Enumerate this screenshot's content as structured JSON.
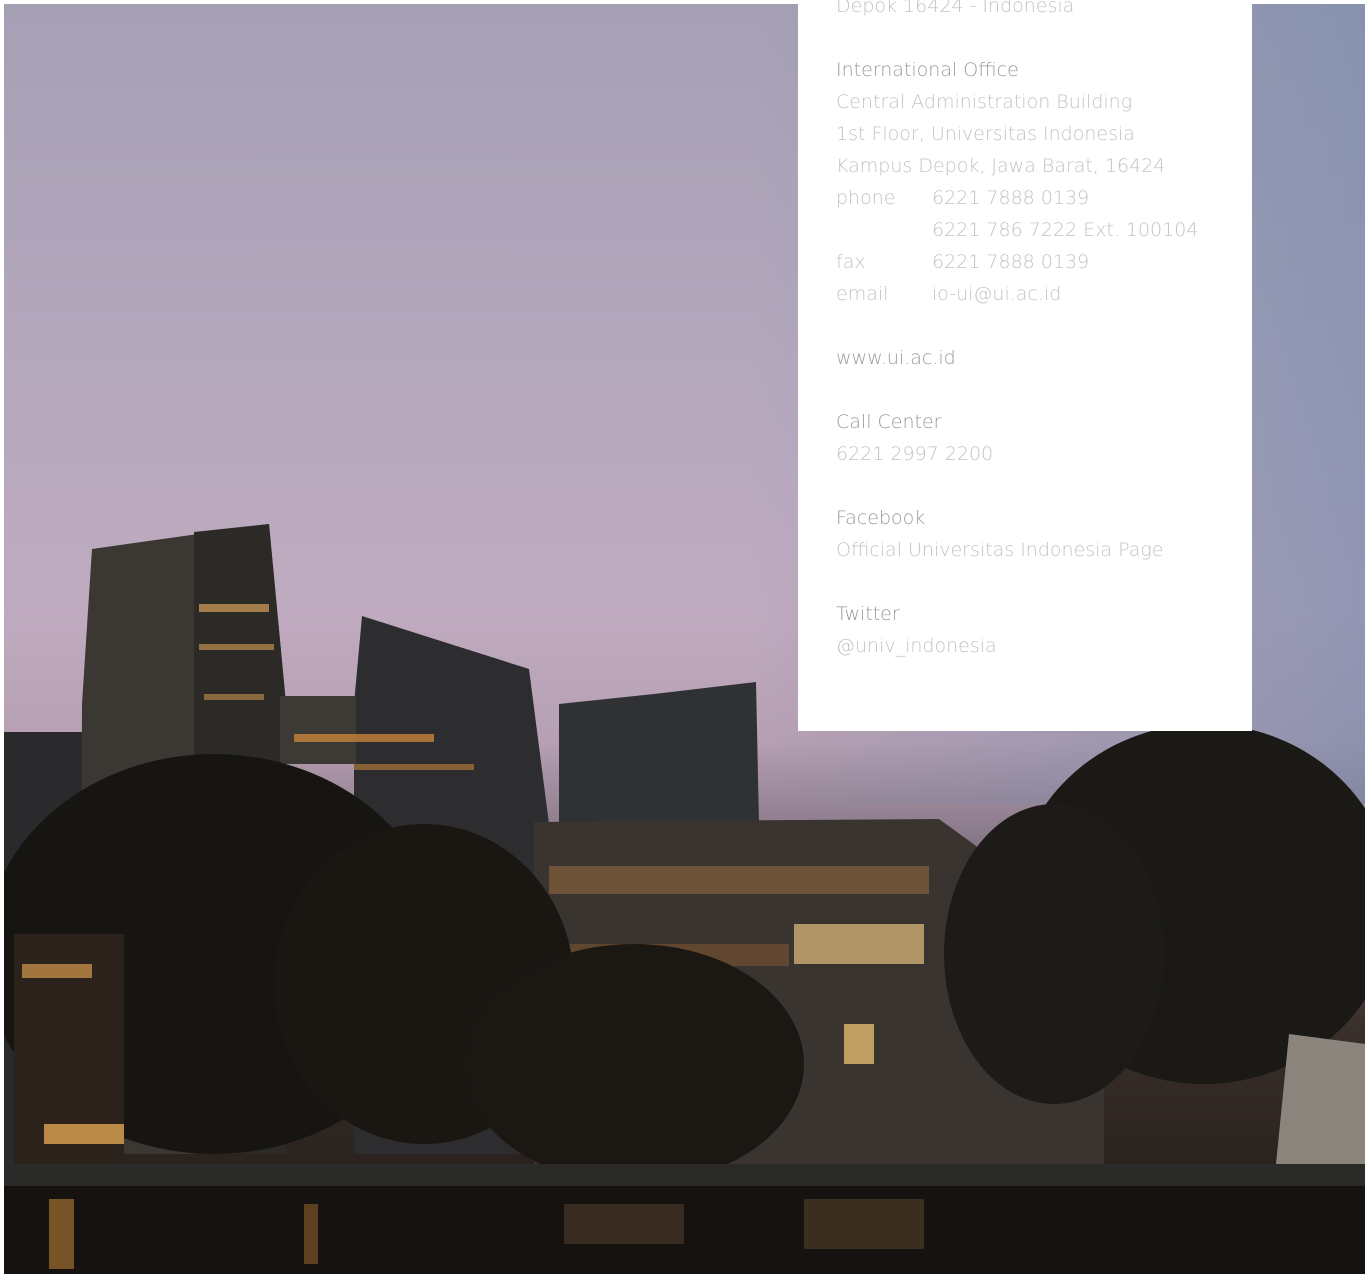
{
  "address_tail": "Depok 16424 - Indonesia",
  "international_office": {
    "heading": "International Office",
    "lines": [
      "Central Administration Building",
      "1st Floor, Universitas Indonesia",
      "Kampus Depok, Jawa Barat, 16424"
    ],
    "phone_label": "phone",
    "phone_1": "6221 7888 0139",
    "phone_2": "6221 786 7222 Ext. 100104",
    "fax_label": "fax",
    "fax": "6221 7888 0139",
    "email_label": "email",
    "email": "io-ui@ui.ac.id"
  },
  "website": "www.ui.ac.id",
  "call_center": {
    "heading": "Call Center",
    "number": "6221 2997 2200"
  },
  "facebook": {
    "heading": "Facebook",
    "link": "Official Universitas Indonesia Page"
  },
  "twitter": {
    "heading": "Twitter",
    "handle": "@univ_indonesia"
  }
}
